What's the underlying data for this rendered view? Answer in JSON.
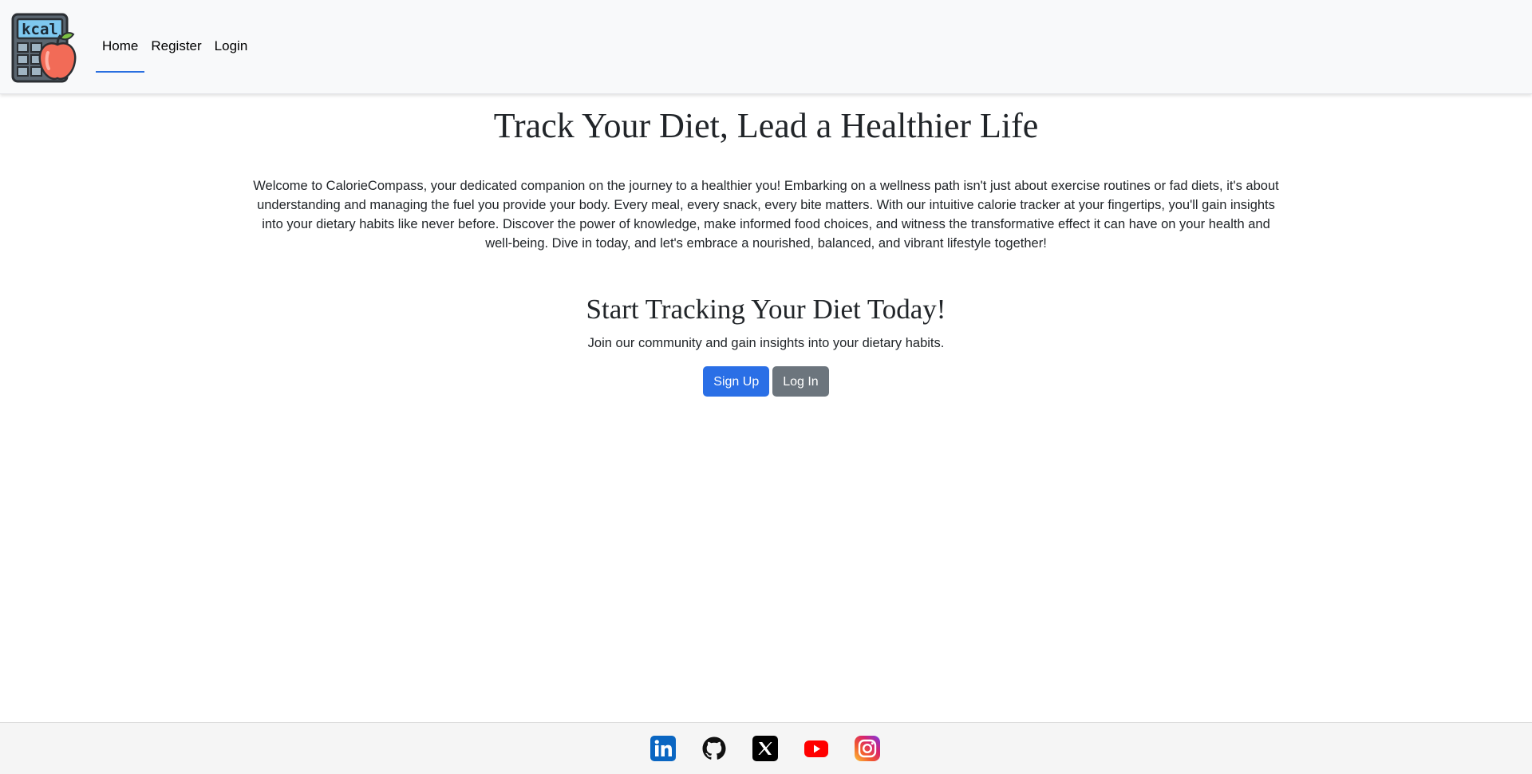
{
  "nav": {
    "logo_icon": "kcal-calculator-apple-logo",
    "logo_text": "kcal",
    "links": [
      {
        "label": "Home",
        "active": true
      },
      {
        "label": "Register",
        "active": false
      },
      {
        "label": "Login",
        "active": false
      }
    ]
  },
  "hero": {
    "title": "Track Your Diet, Lead a Healthier Life",
    "intro": "Welcome to CalorieCompass, your dedicated companion on the journey to a healthier you! Embarking on a wellness path isn't just about exercise routines or fad diets, it's about understanding and managing the fuel you provide your body. Every meal, every snack, every bite matters. With our intuitive calorie tracker at your fingertips, you'll gain insights into your dietary habits like never before. Discover the power of knowledge, make informed food choices, and witness the transformative effect it can have on your health and well-being. Dive in today, and let's embrace a nourished, balanced, and vibrant lifestyle together!"
  },
  "cta": {
    "title": "Start Tracking Your Diet Today!",
    "subtitle": "Join our community and gain insights into your dietary habits.",
    "signup_label": "Sign Up",
    "login_label": "Log In"
  },
  "footer": {
    "socials": [
      "linkedin-icon",
      "github-icon",
      "x-icon",
      "youtube-icon",
      "instagram-icon"
    ]
  },
  "colors": {
    "primary": "#2a6fe6",
    "secondary": "#6c757d",
    "navbar_bg": "#f8f9fa",
    "footer_bg": "#f5f5f5"
  }
}
